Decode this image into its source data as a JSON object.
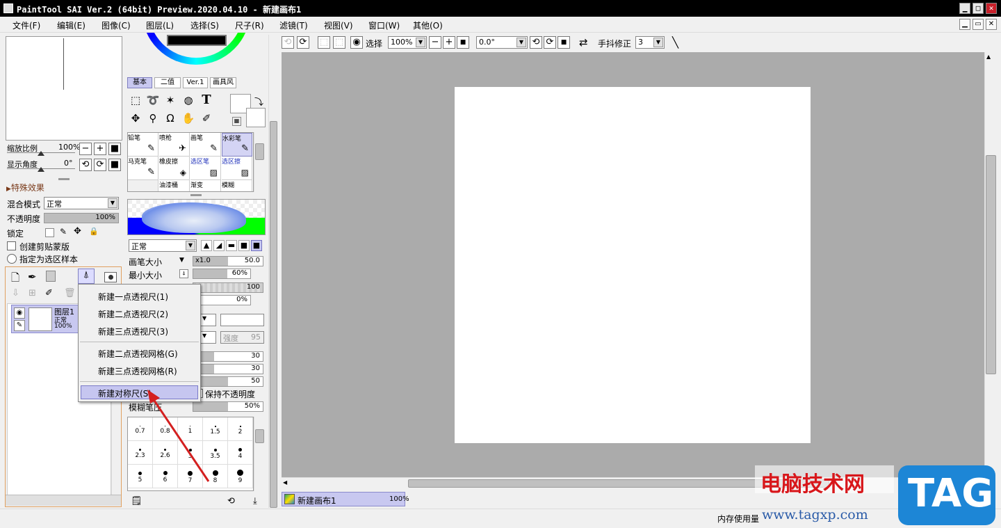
{
  "window": {
    "title": "PaintTool SAI Ver.2 (64bit) Preview.2020.04.10 - 新建画布1",
    "minimize": "▁",
    "maximize": "□",
    "close": "✕",
    "restore": "▭"
  },
  "menubar": {
    "items": [
      "文件(F)",
      "编辑(E)",
      "图像(C)",
      "图层(L)",
      "选择(S)",
      "尺子(R)",
      "滤镜(T)",
      "视图(V)",
      "窗口(W)",
      "其他(O)"
    ]
  },
  "toolbar": {
    "select_label": "选择",
    "zoom_value": "100%",
    "angle_value": "0.0°",
    "stabilizer_label": "手抖修正",
    "stabilizer_value": "3"
  },
  "navigator": {
    "zoom_label": "缩放比例",
    "zoom_value": "100%",
    "angle_label": "显示角度",
    "angle_value": "0°"
  },
  "layer_panel": {
    "effects_label": "特殊效果",
    "blend_label": "混合模式",
    "blend_value": "正常",
    "opacity_label": "不透明度",
    "opacity_value": "100%",
    "lock_label": "锁定",
    "clip_label": "创建剪贴蒙版",
    "selection_source_label": "指定为选区样本",
    "layer": {
      "name": "图层1",
      "mode": "正常",
      "opacity": "100%"
    }
  },
  "context_menu": {
    "items": [
      "新建一点透视尺(1)",
      "新建二点透视尺(2)",
      "新建三点透视尺(3)",
      "新建二点透视网格(G)",
      "新建三点透视网格(R)",
      "新建对称尺(S)"
    ],
    "highlighted": "新建对称尺(S)"
  },
  "tool_panel": {
    "tabs": [
      "基本",
      "二值",
      "Ver.1",
      "画具风"
    ],
    "tools": [
      "pencil",
      "airbrush",
      "brush",
      "watercolor",
      "marker",
      "eraser",
      "select-pen",
      "select-eraser",
      "bucket",
      "gradient",
      "blur"
    ],
    "brush_names": [
      "铅笔",
      "喷枪",
      "画笔",
      "水彩笔",
      "马克笔",
      "橡皮擦",
      "选区笔",
      "选区擦",
      "油漆桶",
      "渐变",
      "模糊"
    ],
    "blend_mode": "正常",
    "brush_size_label": "画笔大小",
    "brush_size_mult": "x1.0",
    "brush_size_value": "50.0",
    "min_size_label": "最小大小",
    "min_size_value": "60%",
    "density_value": "100",
    "zero_value": "0%",
    "blur_label": "模糊笔压",
    "blur_value": "50%",
    "keep_opacity_label": "保持不透明度",
    "strength_label": "强度",
    "strength_value": "95",
    "value30a": "30",
    "value30b": "30",
    "value50": "50",
    "sizes": [
      "0.7",
      "0.8",
      "1",
      "1.5",
      "2",
      "2.3",
      "2.6",
      "3",
      "3.5",
      "4",
      "5",
      "6",
      "7",
      "8",
      "9"
    ]
  },
  "canvas_tabs": [
    {
      "name": "新建画布1",
      "zoom": "100%"
    }
  ],
  "statusbar": {
    "memory_label": "内存使用量"
  },
  "watermark": {
    "cn_text": "电脑技术网",
    "url": "www.tagxp.com",
    "tag": "TAG"
  },
  "colors": {
    "accent": "#c6c6f0",
    "titlebar": "#000000",
    "canvas_bg": "#ababab",
    "arrow": "#d42020"
  }
}
